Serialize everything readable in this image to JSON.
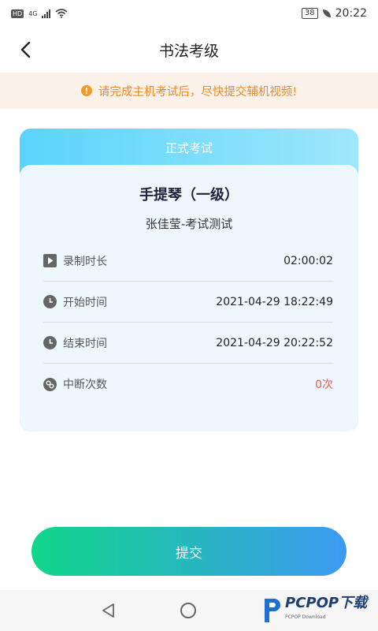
{
  "status_bar": {
    "hd": "HD",
    "network": "4G",
    "battery": "38",
    "time": "20:22"
  },
  "header": {
    "title": "书法考级",
    "back_icon": "chevron-left-icon"
  },
  "notice": {
    "icon": "alert-icon",
    "text": "请完成主机考试后，尽快提交辅机视频!",
    "color": "#f08a24"
  },
  "card": {
    "header": "正式考试",
    "exam_title": "手提琴（一级）",
    "exam_subtitle": "张佳莹-考试测试",
    "rows": [
      {
        "icon": "play-icon",
        "label": "录制时长",
        "value": "02:00:02"
      },
      {
        "icon": "clock-icon",
        "label": "开始时间",
        "value": "2021-04-29 18:22:49"
      },
      {
        "icon": "clock-icon",
        "label": "结束时间",
        "value": "2021-04-29 20:22:52"
      },
      {
        "icon": "link-icon",
        "label": "中断次数",
        "value": "0次"
      }
    ]
  },
  "submit": {
    "label": "提交"
  },
  "watermark": {
    "text": "PCPOP下载",
    "small": "PCPOP Download"
  }
}
